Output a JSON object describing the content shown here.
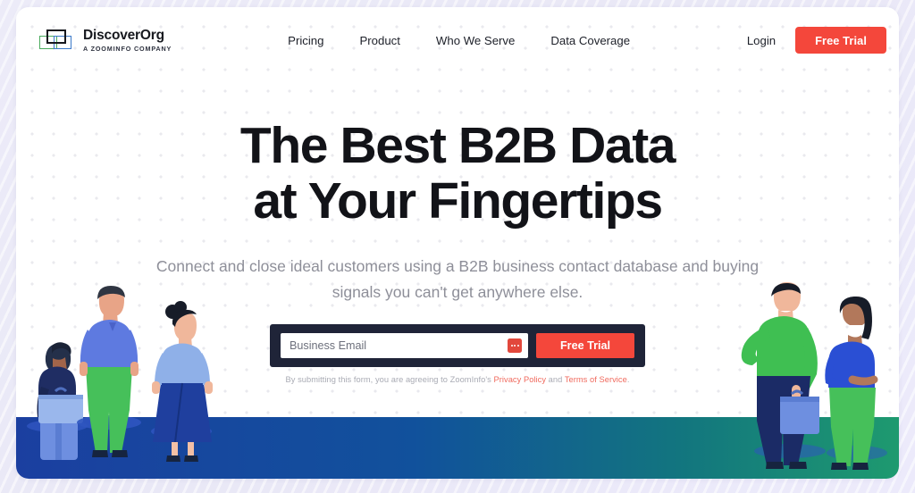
{
  "brand": {
    "name": "DiscoverOrg",
    "tagline": "A ZOOMINFO COMPANY",
    "logo_icon": "overlapping-rectangles-logo-icon",
    "colors": {
      "green": "#4bab5e",
      "blue": "#3a78c9",
      "black": "#16181d"
    }
  },
  "nav": {
    "items": [
      {
        "label": "Pricing"
      },
      {
        "label": "Product"
      },
      {
        "label": "Who We Serve"
      },
      {
        "label": "Data Coverage"
      }
    ],
    "login_label": "Login",
    "trial_label": "Free Trial"
  },
  "hero": {
    "headline_line1": "The Best B2B Data",
    "headline_line2": "at Your Fingertips",
    "subhead_line1": "Connect and close ideal customers using a B2B business contact database and buying",
    "subhead_line2": "signals you can't get anywhere else."
  },
  "form": {
    "email_placeholder": "Business Email",
    "email_value": "",
    "autofill_icon": "autofill-dots-icon",
    "submit_label": "Free Trial",
    "fineprint_prefix": "By submitting this form, you are agreeing to ZoomInfo's ",
    "privacy_link": "Privacy Policy",
    "fineprint_middle": " and ",
    "terms_link": "Terms of Service",
    "fineprint_suffix": "."
  },
  "theme": {
    "accent_red": "#f4473b",
    "form_navy": "#1f2438",
    "page_bg": "#eae9f7",
    "card_bg": "#ffffff",
    "floor_left": "#1b3fa0",
    "floor_right": "#169089"
  }
}
